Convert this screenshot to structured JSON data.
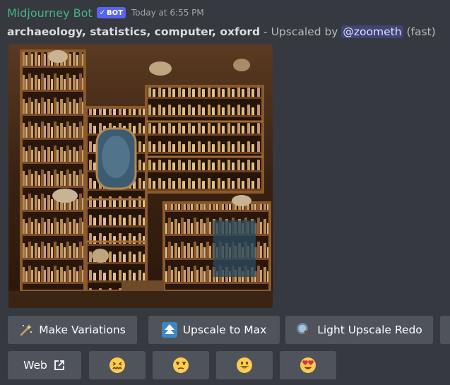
{
  "message": {
    "author": "Midjourney Bot",
    "bot_tag": "BOT",
    "timestamp": "Today at 6:55 PM",
    "prompt": "archaeology, statistics, computer, oxford",
    "separator": " - ",
    "upscaled_by": "Upscaled by ",
    "mention": "@zoometh",
    "speed": " (fast)"
  },
  "image": {
    "icon": "generated-image",
    "subject": "cabinet of curiosities"
  },
  "buttons_row1": [
    {
      "label": "Make Variations",
      "icon": "magic-wand-icon"
    },
    {
      "label": "Upscale to Max",
      "icon": "upscale-arrow-icon"
    },
    {
      "label": "Light Upscale Redo",
      "icon": "magnifier-icon"
    }
  ],
  "buttons_row2": [
    {
      "label": "Web",
      "icon": "external-link-icon"
    },
    {
      "label": "",
      "icon": "confounded-face-emoji"
    },
    {
      "label": "",
      "icon": "unamused-face-emoji"
    },
    {
      "label": "",
      "icon": "grinning-face-emoji"
    },
    {
      "label": "",
      "icon": "heart-eyes-emoji"
    }
  ],
  "colors": {
    "background": "#36393f",
    "author": "#43b581",
    "bot_tag": "#5865f2",
    "button": "#4f545c",
    "mention_bg": "#454c85"
  }
}
